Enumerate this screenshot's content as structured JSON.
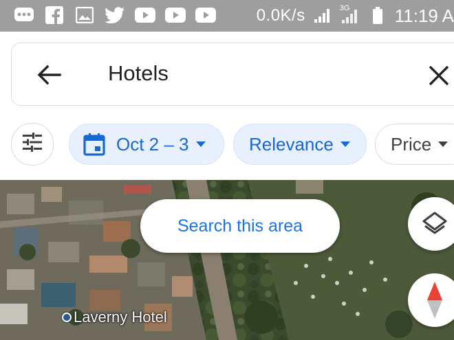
{
  "status_bar": {
    "left_icons": [
      "message-icon",
      "facebook-icon",
      "gallery-icon",
      "twitter-icon",
      "youtube-icon",
      "youtube-icon",
      "youtube-icon"
    ],
    "net_speed": "0.0K/s",
    "network": "3G",
    "time": "11:19 A"
  },
  "search": {
    "query": "Hotels"
  },
  "filters": {
    "date_label": "Oct 2 – 3",
    "sort_label": "Relevance",
    "price_label": "Price"
  },
  "map": {
    "search_area_label": "Search this area",
    "places": [
      {
        "name": "Laverny Hotel"
      }
    ]
  },
  "colors": {
    "accent": "#1a73e8",
    "chip_selected_bg": "#e8f0fe",
    "status_bar": "#9e9e9e",
    "compass_red": "#ea4335"
  }
}
